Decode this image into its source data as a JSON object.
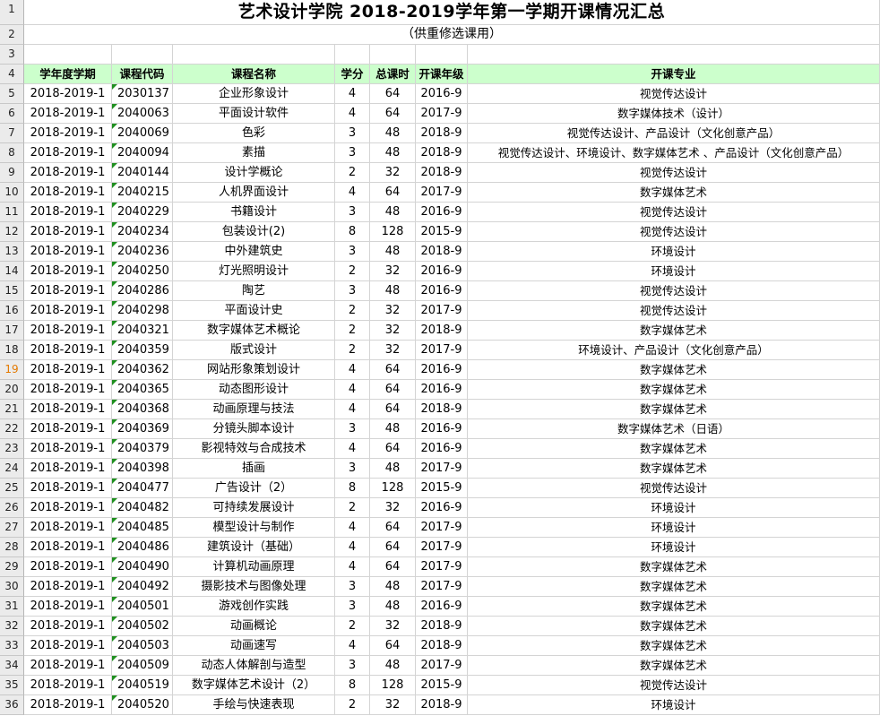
{
  "sheet": {
    "title": "艺术设计学院 2018-2019学年第一学期开课情况汇总",
    "subtitle": "（供重修选课用）",
    "selected_row": 19,
    "headers": [
      "学年度学期",
      "课程代码",
      "课程名称",
      "学分",
      "总课时",
      "开课年级",
      "开课专业"
    ],
    "rows": [
      [
        "2018-2019-1",
        "2030137",
        "企业形象设计",
        "4",
        "64",
        "2016-9",
        "视觉传达设计"
      ],
      [
        "2018-2019-1",
        "2040063",
        "平面设计软件",
        "4",
        "64",
        "2017-9",
        "数字媒体技术（设计）"
      ],
      [
        "2018-2019-1",
        "2040069",
        "色彩",
        "3",
        "48",
        "2018-9",
        "视觉传达设计、产品设计（文化创意产品）"
      ],
      [
        "2018-2019-1",
        "2040094",
        "素描",
        "3",
        "48",
        "2018-9",
        "视觉传达设计、环境设计、数字媒体艺术 、产品设计（文化创意产品）"
      ],
      [
        "2018-2019-1",
        "2040144",
        "设计学概论",
        "2",
        "32",
        "2018-9",
        "视觉传达设计"
      ],
      [
        "2018-2019-1",
        "2040215",
        "人机界面设计",
        "4",
        "64",
        "2017-9",
        "数字媒体艺术"
      ],
      [
        "2018-2019-1",
        "2040229",
        "书籍设计",
        "3",
        "48",
        "2016-9",
        "视觉传达设计"
      ],
      [
        "2018-2019-1",
        "2040234",
        "包装设计(2)",
        "8",
        "128",
        "2015-9",
        "视觉传达设计"
      ],
      [
        "2018-2019-1",
        "2040236",
        "中外建筑史",
        "3",
        "48",
        "2018-9",
        "环境设计"
      ],
      [
        "2018-2019-1",
        "2040250",
        "灯光照明设计",
        "2",
        "32",
        "2016-9",
        "环境设计"
      ],
      [
        "2018-2019-1",
        "2040286",
        "陶艺",
        "3",
        "48",
        "2016-9",
        "视觉传达设计"
      ],
      [
        "2018-2019-1",
        "2040298",
        "平面设计史",
        "2",
        "32",
        "2017-9",
        "视觉传达设计"
      ],
      [
        "2018-2019-1",
        "2040321",
        "数字媒体艺术概论",
        "2",
        "32",
        "2018-9",
        "数字媒体艺术"
      ],
      [
        "2018-2019-1",
        "2040359",
        "版式设计",
        "2",
        "32",
        "2017-9",
        "环境设计、产品设计（文化创意产品）"
      ],
      [
        "2018-2019-1",
        "2040362",
        "网站形象策划设计",
        "4",
        "64",
        "2016-9",
        "数字媒体艺术"
      ],
      [
        "2018-2019-1",
        "2040365",
        "动态图形设计",
        "4",
        "64",
        "2016-9",
        "数字媒体艺术"
      ],
      [
        "2018-2019-1",
        "2040368",
        "动画原理与技法",
        "4",
        "64",
        "2018-9",
        "数字媒体艺术"
      ],
      [
        "2018-2019-1",
        "2040369",
        "分镜头脚本设计",
        "3",
        "48",
        "2016-9",
        "数字媒体艺术（日语）"
      ],
      [
        "2018-2019-1",
        "2040379",
        "影视特效与合成技术",
        "4",
        "64",
        "2016-9",
        "数字媒体艺术"
      ],
      [
        "2018-2019-1",
        "2040398",
        "插画",
        "3",
        "48",
        "2017-9",
        "数字媒体艺术"
      ],
      [
        "2018-2019-1",
        "2040477",
        "广告设计（2）",
        "8",
        "128",
        "2015-9",
        "视觉传达设计"
      ],
      [
        "2018-2019-1",
        "2040482",
        "可持续发展设计",
        "2",
        "32",
        "2016-9",
        "环境设计"
      ],
      [
        "2018-2019-1",
        "2040485",
        "模型设计与制作",
        "4",
        "64",
        "2017-9",
        "环境设计"
      ],
      [
        "2018-2019-1",
        "2040486",
        "建筑设计（基础）",
        "4",
        "64",
        "2017-9",
        "环境设计"
      ],
      [
        "2018-2019-1",
        "2040490",
        "计算机动画原理",
        "4",
        "64",
        "2017-9",
        "数字媒体艺术"
      ],
      [
        "2018-2019-1",
        "2040492",
        "摄影技术与图像处理",
        "3",
        "48",
        "2017-9",
        "数字媒体艺术"
      ],
      [
        "2018-2019-1",
        "2040501",
        "游戏创作实践",
        "3",
        "48",
        "2016-9",
        "数字媒体艺术"
      ],
      [
        "2018-2019-1",
        "2040502",
        "动画概论",
        "2",
        "32",
        "2018-9",
        "数字媒体艺术"
      ],
      [
        "2018-2019-1",
        "2040503",
        "动画速写",
        "4",
        "64",
        "2018-9",
        "数字媒体艺术"
      ],
      [
        "2018-2019-1",
        "2040509",
        "动态人体解剖与造型",
        "3",
        "48",
        "2017-9",
        "数字媒体艺术"
      ],
      [
        "2018-2019-1",
        "2040519",
        "数字媒体艺术设计（2）",
        "8",
        "128",
        "2015-9",
        "视觉传达设计"
      ],
      [
        "2018-2019-1",
        "2040520",
        "手绘与快速表现",
        "2",
        "32",
        "2018-9",
        "环境设计"
      ]
    ]
  },
  "colors": {
    "header_fill": "#ccffcc",
    "selected_row_number": "#e47a00",
    "comment_marker": "#1f8f1f"
  }
}
